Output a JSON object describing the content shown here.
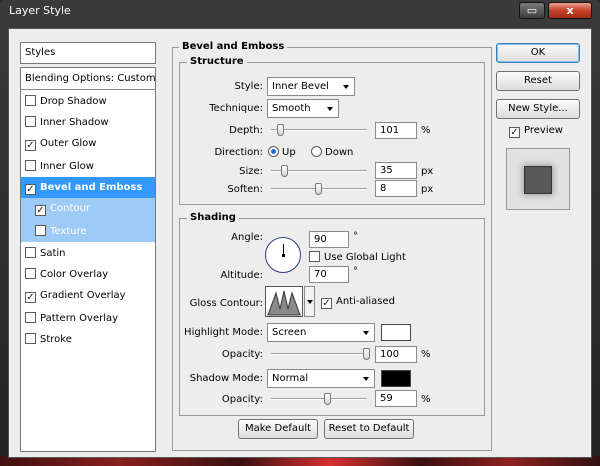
{
  "titlebar": {
    "title": "Layer Style",
    "btn_restore": "▭",
    "btn_close": "x"
  },
  "styles_header": "Styles",
  "style_list": [
    {
      "label": "Blending Options: Custom",
      "checkbox": false,
      "checked": false
    },
    {
      "label": "Drop Shadow",
      "checkbox": true,
      "checked": false
    },
    {
      "label": "Inner Shadow",
      "checkbox": true,
      "checked": false
    },
    {
      "label": "Outer Glow",
      "checkbox": true,
      "checked": true
    },
    {
      "label": "Inner Glow",
      "checkbox": true,
      "checked": false
    },
    {
      "label": "Bevel and Emboss",
      "checkbox": true,
      "checked": true,
      "selected": true
    },
    {
      "label": "Contour",
      "checkbox": true,
      "checked": true,
      "sub": true
    },
    {
      "label": "Texture",
      "checkbox": true,
      "checked": false,
      "sub": true
    },
    {
      "label": "Satin",
      "checkbox": true,
      "checked": false
    },
    {
      "label": "Color Overlay",
      "checkbox": true,
      "checked": false
    },
    {
      "label": "Gradient Overlay",
      "checkbox": true,
      "checked": true
    },
    {
      "label": "Pattern Overlay",
      "checkbox": true,
      "checked": false
    },
    {
      "label": "Stroke",
      "checkbox": true,
      "checked": false
    }
  ],
  "bevel": {
    "group_title": "Bevel and Emboss",
    "structure_title": "Structure",
    "style_label": "Style:",
    "style_value": "Inner Bevel",
    "technique_label": "Technique:",
    "technique_value": "Smooth",
    "depth_label": "Depth:",
    "depth_value": "101",
    "depth_unit": "%",
    "depth_slider": 0.1,
    "direction_label": "Direction:",
    "dir_up": "Up",
    "dir_down": "Down",
    "direction_selected": "Up",
    "size_label": "Size:",
    "size_value": "35",
    "size_unit": "px",
    "size_slider": 0.15,
    "soften_label": "Soften:",
    "soften_value": "8",
    "soften_unit": "px",
    "soften_slider": 0.5
  },
  "shading": {
    "title": "Shading",
    "angle_label": "Angle:",
    "angle_value": "90",
    "angle_unit": "°",
    "global_light_label": "Use Global Light",
    "global_light_checked": false,
    "altitude_label": "Altitude:",
    "altitude_value": "70",
    "altitude_unit": "°",
    "gloss_label": "Gloss Contour:",
    "anti_aliased_label": "Anti-aliased",
    "anti_aliased_checked": true,
    "highlight_mode_label": "Highlight Mode:",
    "highlight_mode_value": "Screen",
    "highlight_color": "#ffffff",
    "hl_opacity_label": "Opacity:",
    "hl_opacity_value": "100",
    "hl_opacity_unit": "%",
    "hl_opacity_slider": 1.0,
    "shadow_mode_label": "Shadow Mode:",
    "shadow_mode_value": "Normal",
    "shadow_color": "#000000",
    "sh_opacity_label": "Opacity:",
    "sh_opacity_value": "59",
    "sh_opacity_unit": "%",
    "sh_opacity_slider": 0.59
  },
  "footer": {
    "make_default": "Make Default",
    "reset_default": "Reset to Default"
  },
  "side": {
    "ok": "OK",
    "reset": "Reset",
    "new_style": "New Style...",
    "preview_label": "Preview",
    "preview_checked": true
  }
}
